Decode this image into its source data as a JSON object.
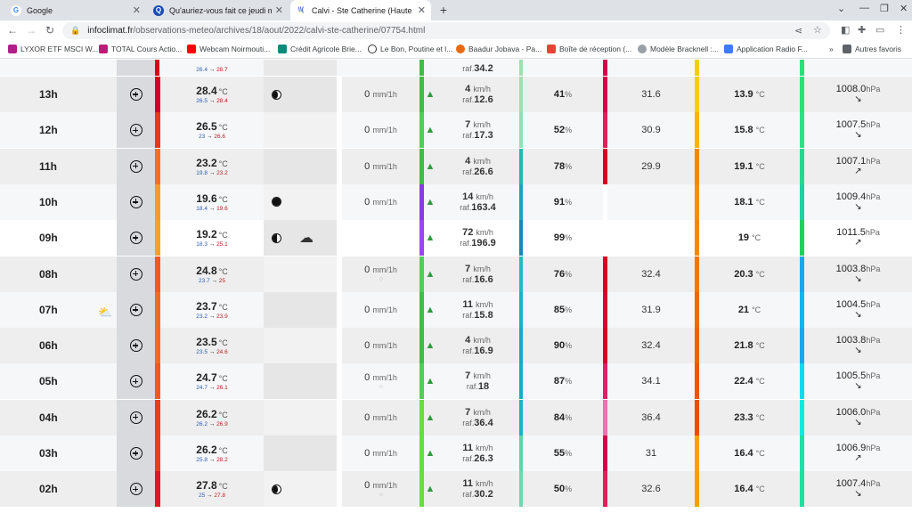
{
  "browser": {
    "tabs": [
      {
        "title": "Google",
        "favicon": "G",
        "active": false
      },
      {
        "title": "Qu'auriez-vous fait ce jeudi matin",
        "favicon": "Q",
        "active": false
      },
      {
        "title": "Calvi - Ste Catherine (Haute Corse)",
        "favicon": "\\\\(",
        "active": true
      }
    ],
    "url_host": "infoclimat.fr",
    "url_path": "/observations-meteo/archives/18/aout/2022/calvi-ste-catherine/07754.html",
    "bookmarks": [
      "LYXOR ETF MSCI W...",
      "TOTAL Cours Actio...",
      "Webcam Noirmouti...",
      "Crédit Agricole Brie...",
      "Le Bon, Poutine et l...",
      "Baadur Jobava - Pa...",
      "Boîte de réception (...",
      "Modèle Bracknell :...",
      "Application Radio F..."
    ],
    "bookmarks_more": "»",
    "other_bookmarks": "Autres favoris"
  },
  "units": {
    "temp": "°C",
    "rain": "mm/1h",
    "wind": "km/h",
    "gust_prefix": "raf.",
    "humidity": "%",
    "pressure": "hPa"
  },
  "top_partial": {
    "range_lo": "26.4",
    "range_hi": "28.7",
    "gust": "34.2"
  },
  "rows": [
    {
      "hour": "13h",
      "temp": "28.4",
      "lo": "26.5",
      "hi": "28.4",
      "moon": "waning",
      "rain": "0",
      "drops": false,
      "wind": "4",
      "gust": "12.6",
      "humidity": "41",
      "sun": "31.6",
      "dew": "13.9",
      "pressure": "1008.0",
      "trend": "↘",
      "tempColor": "#d7001e",
      "windColor": "#44bb44",
      "humColor": "#a0e0b0",
      "sunColor": "#d7004a",
      "dewColor": "#f0d000",
      "presColor": "#29e07a",
      "rowBg": "#eeeeee"
    },
    {
      "hour": "12h",
      "temp": "26.5",
      "lo": "23",
      "hi": "26.6",
      "moon": "",
      "rain": "0",
      "drops": false,
      "wind": "7",
      "gust": "17.3",
      "humidity": "52",
      "sun": "30.9",
      "dew": "15.8",
      "pressure": "1007.5",
      "trend": "↘",
      "tempColor": "#e43a1c",
      "windColor": "#55cc55",
      "humColor": "#90dfb5",
      "sunColor": "#e0205a",
      "dewColor": "#f7b500",
      "presColor": "#30e085",
      "rowBg": "#f6f7f9"
    },
    {
      "hour": "11h",
      "temp": "23.2",
      "lo": "19.8",
      "hi": "23.2",
      "moon": "",
      "rain": "0",
      "drops": false,
      "wind": "4",
      "gust": "26.6",
      "humidity": "78",
      "sun": "29.9",
      "dew": "19.1",
      "pressure": "1007.1",
      "trend": "↗",
      "tempColor": "#f07028",
      "windColor": "#44bb44",
      "humColor": "#20b8b0",
      "sunColor": "#d7002a",
      "dewColor": "#f08a00",
      "presColor": "#25d890",
      "rowBg": "#eeeeee"
    },
    {
      "hour": "10h",
      "temp": "19.6",
      "lo": "18.4",
      "hi": "19.6",
      "moon": "full",
      "rain": "0",
      "drops": false,
      "wind": "14",
      "gust": "163.4",
      "humidity": "91",
      "sun": "",
      "dew": "18.1",
      "pressure": "1009.4",
      "trend": "↘",
      "tempColor": "#f59a30",
      "windColor": "#8a3ce0",
      "humColor": "#1fa0c0",
      "sunColor": "",
      "dewColor": "#f09200",
      "presColor": "#20d0a0",
      "rowBg": "#f6f7f9"
    },
    {
      "hour": "09h",
      "temp": "19.2",
      "lo": "18.3",
      "hi": "25.1",
      "moon": "half",
      "cloud": true,
      "rain": "",
      "drops": false,
      "wind": "72",
      "gust": "196.9",
      "humidity": "99",
      "sun": "",
      "dew": "19",
      "pressure": "1011.5",
      "trend": "↗",
      "tempColor": "#f5a030",
      "windColor": "#9a46f0",
      "humColor": "#1a85b8",
      "sunColor": "",
      "dewColor": "#f08a00",
      "presColor": "#1fd060",
      "rowBg": "#ffffff"
    },
    {
      "hour": "08h",
      "temp": "24.8",
      "lo": "23.7",
      "hi": "25",
      "moon": "",
      "rain": "0",
      "drops": true,
      "wind": "7",
      "gust": "16.6",
      "humidity": "76",
      "sun": "32.4",
      "dew": "20.3",
      "pressure": "1003.8",
      "trend": "↘",
      "tempColor": "#ee5a22",
      "windColor": "#55cc55",
      "humColor": "#22bac0",
      "sunColor": "#d7002a",
      "dewColor": "#f07800",
      "presColor": "#1aa6ee",
      "rowBg": "#eeeeee"
    },
    {
      "hour": "07h",
      "sunrise": true,
      "temp": "23.7",
      "lo": "23.2",
      "hi": "23.9",
      "moon": "",
      "rain": "0",
      "drops": false,
      "wind": "11",
      "gust": "15.8",
      "humidity": "85",
      "sun": "31.9",
      "dew": "21",
      "pressure": "1004.5",
      "trend": "↘",
      "tempColor": "#f06a26",
      "windColor": "#44bb44",
      "humColor": "#1ab0c8",
      "sunColor": "#d7003a",
      "dewColor": "#f06800",
      "presColor": "#10b6f0",
      "rowBg": "#f6f7f9"
    },
    {
      "hour": "06h",
      "temp": "23.5",
      "lo": "23.5",
      "hi": "24.6",
      "moon": "",
      "rain": "0",
      "drops": false,
      "wind": "4",
      "gust": "16.9",
      "humidity": "90",
      "sun": "32.4",
      "dew": "21.8",
      "pressure": "1003.8",
      "trend": "↘",
      "tempColor": "#f06a26",
      "windColor": "#44bb44",
      "humColor": "#18a8c8",
      "sunColor": "#d7002a",
      "dewColor": "#f05f00",
      "presColor": "#1aa6ee",
      "rowBg": "#eeeeee"
    },
    {
      "hour": "05h",
      "temp": "24.7",
      "lo": "24.7",
      "hi": "26.1",
      "moon": "",
      "rain": "0",
      "drops": true,
      "wind": "7",
      "gust": "18",
      "humidity": "87",
      "sun": "34.1",
      "dew": "22.4",
      "pressure": "1005.5",
      "trend": "↘",
      "tempColor": "#ee5a22",
      "windColor": "#55cc55",
      "humColor": "#18acc8",
      "sunColor": "#e0206a",
      "dewColor": "#f05500",
      "presColor": "#10d8f0",
      "rowBg": "#f6f7f9"
    },
    {
      "hour": "04h",
      "temp": "26.2",
      "lo": "26.2",
      "hi": "26.9",
      "moon": "",
      "rain": "0",
      "drops": false,
      "wind": "7",
      "gust": "36.4",
      "humidity": "84",
      "sun": "36.4",
      "dew": "23.3",
      "pressure": "1006.0",
      "trend": "↘",
      "tempColor": "#e4401c",
      "windColor": "#66dd44",
      "humColor": "#1ab2c6",
      "sunColor": "#f070b0",
      "dewColor": "#f04a00",
      "presColor": "#12e8e0",
      "rowBg": "#eeeeee"
    },
    {
      "hour": "03h",
      "temp": "26.2",
      "lo": "25.8",
      "hi": "28.2",
      "moon": "",
      "rain": "0",
      "drops": false,
      "wind": "11",
      "gust": "26.3",
      "humidity": "55",
      "sun": "31",
      "dew": "16.4",
      "pressure": "1006.9",
      "trend": "↗",
      "tempColor": "#e4401c",
      "windColor": "#66dd44",
      "humColor": "#60d4a8",
      "sunColor": "#d7004a",
      "dewColor": "#f5a200",
      "presColor": "#1ee0a8",
      "rowBg": "#f6f7f9"
    },
    {
      "hour": "02h",
      "temp": "27.8",
      "lo": "25",
      "hi": "27.8",
      "moon": "waning",
      "rain": "0",
      "drops": true,
      "wind": "11",
      "gust": "30.2",
      "humidity": "50",
      "sun": "32.6",
      "dew": "16.4",
      "pressure": "1007.4",
      "trend": "↘",
      "tempColor": "#da1a1e",
      "windColor": "#66dd44",
      "humColor": "#70d8b0",
      "sunColor": "#e0205a",
      "dewColor": "#f5a200",
      "presColor": "#20e0a0",
      "rowBg": "#eeeeee"
    }
  ]
}
